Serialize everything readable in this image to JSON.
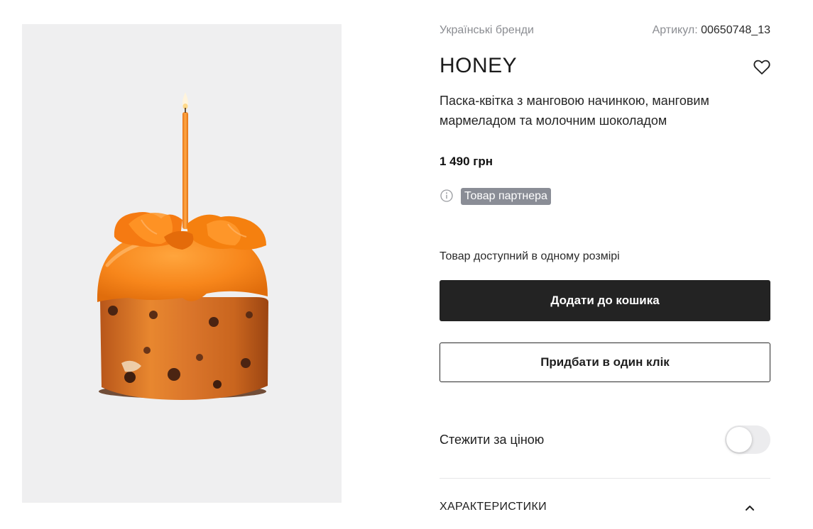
{
  "product": {
    "brand": "Українські бренди",
    "sku_label": "Артикул:",
    "sku_value": "00650748_13",
    "title": "HONEY",
    "description": "Паска-квітка з манговою начинкою, манговим мармеладом та молочним шоколадом",
    "price": "1 490 грн",
    "partner_badge": "Товар партнера",
    "size_note": "Товар доступний в одному розмірі"
  },
  "actions": {
    "add_to_cart": "Додати до кошика",
    "one_click": "Придбати в один клік"
  },
  "price_watch": {
    "label": "Стежити за ціною",
    "enabled": false
  },
  "accordion": {
    "title": "ХАРАКТЕРИСТИКИ",
    "expanded": true
  },
  "icons": {
    "favorite": "heart-outline-icon",
    "info": "info-circle-icon",
    "accordion_toggle": "chevron-up-icon"
  },
  "colors": {
    "primary_button": "#232323",
    "badge": "#8a8d96",
    "gallery_bg": "#efeff0",
    "accent_glaze": "#f7861b"
  }
}
